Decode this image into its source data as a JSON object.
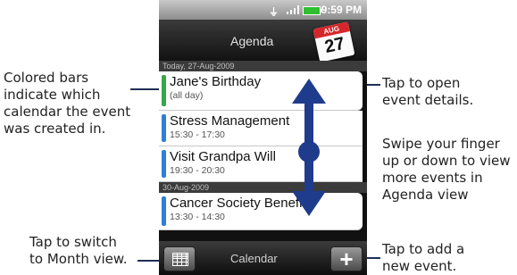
{
  "status_bar": {
    "time": "9:59 PM"
  },
  "title_bar": {
    "title": "Agenda",
    "calendar_icon": {
      "month": "AUG",
      "day": "27"
    }
  },
  "sections": [
    {
      "header": "Today, 27-Aug-2009",
      "events": [
        {
          "name": "Jane's Birthday",
          "time": "(all day)",
          "color": "#36a84a"
        },
        {
          "name": "Stress Management",
          "time": "15:30 - 17:30",
          "color": "#2f7fd6"
        },
        {
          "name": "Visit Grandpa Will",
          "time": "19:30 - 20:30",
          "color": "#2f7fd6"
        }
      ]
    },
    {
      "header": "30-Aug-2009",
      "events": [
        {
          "name": "Cancer Society Benefit",
          "time": "13:30 - 14:30",
          "color": "#2f7fd6"
        }
      ]
    }
  ],
  "bottom_bar": {
    "label": "Calendar"
  },
  "callouts": {
    "colored_bars": [
      "Colored bars",
      "indicate which",
      "calendar the event",
      "was created in."
    ],
    "tap_open": [
      "Tap to open",
      "event details."
    ],
    "swipe": [
      "Swipe your finger",
      "up or down to view",
      "more events in",
      "Agenda view"
    ],
    "month_view": [
      "Tap to switch",
      "to Month view."
    ],
    "add_event": [
      "Tap to add a",
      "new event."
    ]
  },
  "colors": {
    "gesture": "#1f3c8c",
    "callout_line": "#1f2f56"
  }
}
